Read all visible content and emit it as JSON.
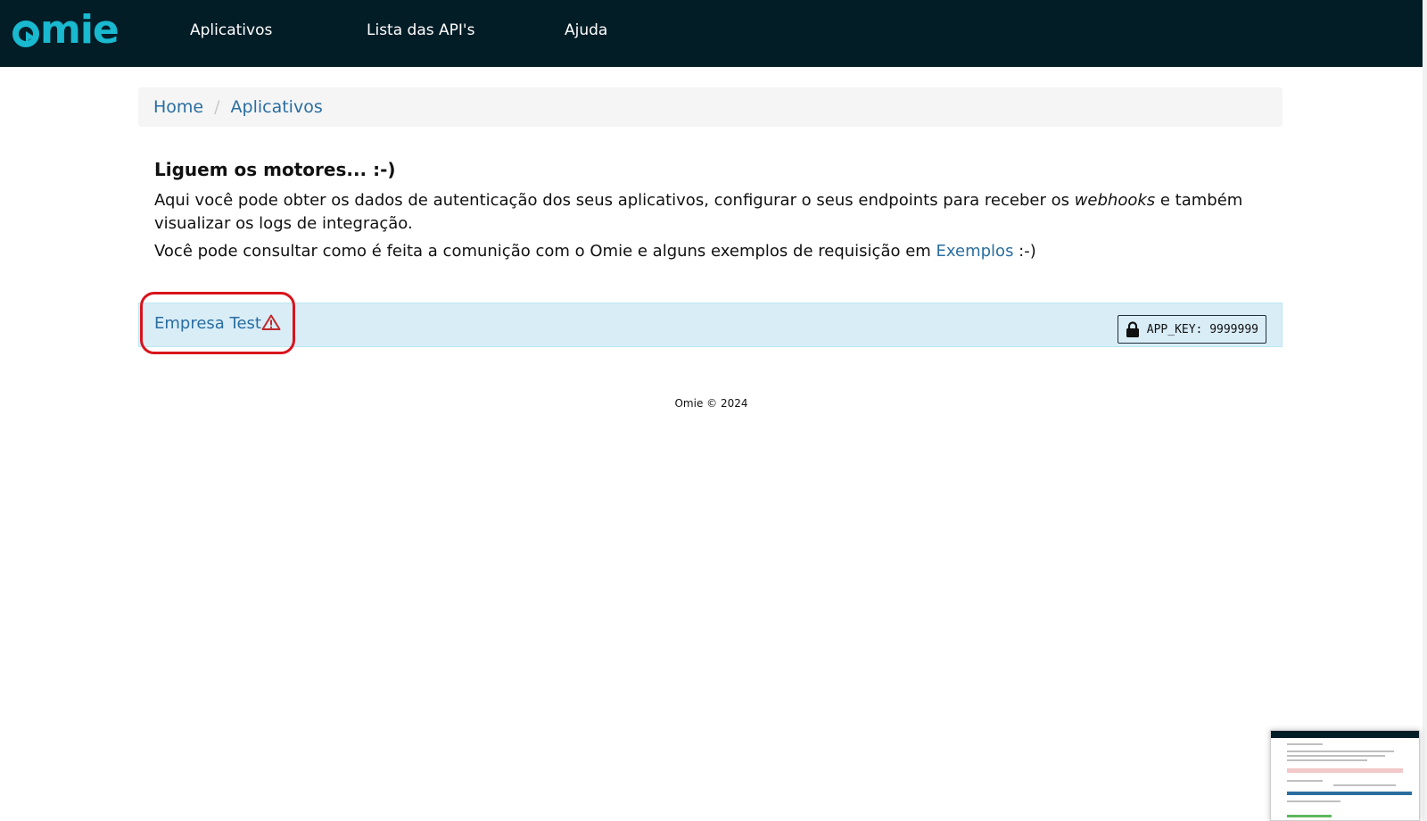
{
  "navbar": {
    "logo_text": "mie",
    "links": [
      {
        "label": "Aplicativos"
      },
      {
        "label": "Lista das API's"
      },
      {
        "label": "Ajuda"
      }
    ]
  },
  "breadcrumb": {
    "items": [
      {
        "label": "Home"
      },
      {
        "label": "Aplicativos"
      }
    ],
    "separator": "/"
  },
  "intro": {
    "heading": "Liguem os motores... :-)",
    "para1_before": "Aqui você pode obter os dados de autenticação dos seus aplicativos, configurar o seus endpoints para receber os ",
    "para1_em": "webhooks",
    "para1_after": " e também visualizar os logs de integração.",
    "para2_before": "Você pode consultar como é feita a comunição com o Omie e alguns exemplos de requisição em ",
    "para2_link": "Exemplos",
    "para2_after": " :-)"
  },
  "app": {
    "company_name": "Empresa Test",
    "warning_icon": "warning-triangle-icon",
    "app_key_label": "APP_KEY: 9999999",
    "lock_icon": "lock-icon"
  },
  "footer": {
    "text": "Omie © 2024"
  },
  "colors": {
    "navbar_bg": "#031d27",
    "brand_accent": "#19b9cf",
    "link": "#2a6ea0",
    "panel_bg": "#d9edf7",
    "highlight_ring": "#d8141c"
  }
}
